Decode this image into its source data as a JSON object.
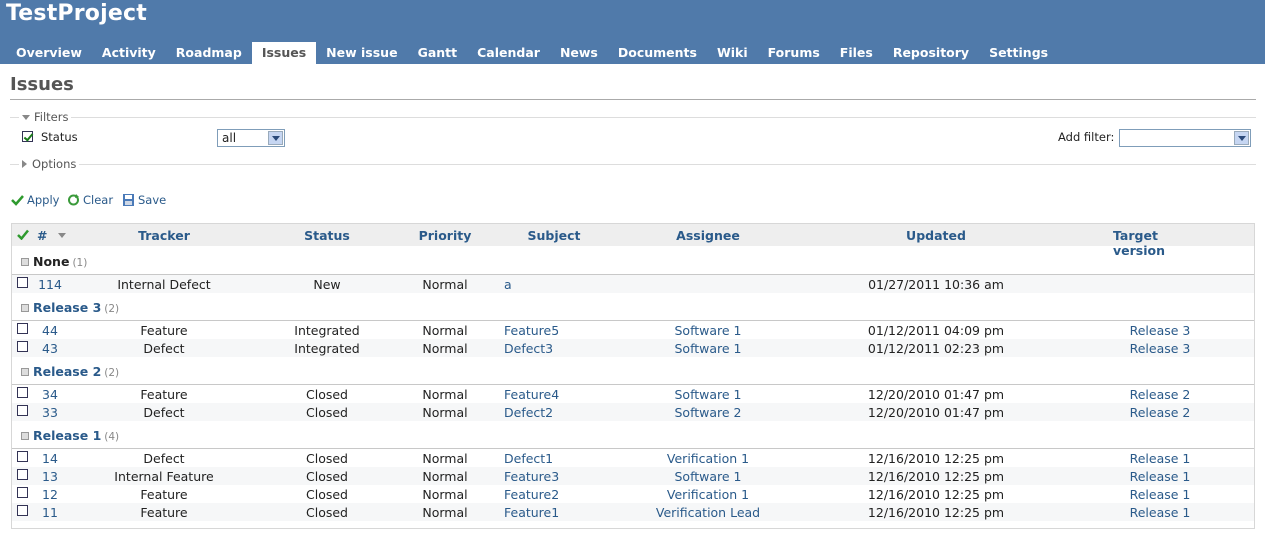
{
  "project": {
    "title": "TestProject"
  },
  "menu": [
    {
      "label": "Overview",
      "selected": false
    },
    {
      "label": "Activity",
      "selected": false
    },
    {
      "label": "Roadmap",
      "selected": false
    },
    {
      "label": "Issues",
      "selected": true
    },
    {
      "label": "New issue",
      "selected": false
    },
    {
      "label": "Gantt",
      "selected": false
    },
    {
      "label": "Calendar",
      "selected": false
    },
    {
      "label": "News",
      "selected": false
    },
    {
      "label": "Documents",
      "selected": false
    },
    {
      "label": "Wiki",
      "selected": false
    },
    {
      "label": "Forums",
      "selected": false
    },
    {
      "label": "Files",
      "selected": false
    },
    {
      "label": "Repository",
      "selected": false
    },
    {
      "label": "Settings",
      "selected": false
    }
  ],
  "page": {
    "title": "Issues"
  },
  "filters": {
    "legend": "Filters",
    "status_label": "Status",
    "status_checked": true,
    "status_value": "all",
    "add_filter_label": "Add filter:",
    "add_filter_value": ""
  },
  "options": {
    "legend": "Options"
  },
  "actions": {
    "apply": "Apply",
    "clear": "Clear",
    "save": "Save"
  },
  "table": {
    "columns": {
      "id": "#",
      "tracker": "Tracker",
      "status": "Status",
      "priority": "Priority",
      "subject": "Subject",
      "assignee": "Assignee",
      "updated": "Updated",
      "target_version": "Target version"
    },
    "groups": [
      {
        "name": "None",
        "count": "(1)",
        "issues": [
          {
            "id": "114",
            "tracker": "Internal Defect",
            "status": "New",
            "priority": "Normal",
            "subject": "a",
            "assignee": "",
            "updated": "01/27/2011 10:36 am",
            "target_version": ""
          }
        ]
      },
      {
        "name": "Release 3",
        "count": "(2)",
        "issues": [
          {
            "id": "44",
            "tracker": "Feature",
            "status": "Integrated",
            "priority": "Normal",
            "subject": "Feature5",
            "assignee": "Software 1",
            "updated": "01/12/2011 04:09 pm",
            "target_version": "Release 3"
          },
          {
            "id": "43",
            "tracker": "Defect",
            "status": "Integrated",
            "priority": "Normal",
            "subject": "Defect3",
            "assignee": "Software 1",
            "updated": "01/12/2011 02:23 pm",
            "target_version": "Release 3"
          }
        ]
      },
      {
        "name": "Release 2",
        "count": "(2)",
        "issues": [
          {
            "id": "34",
            "tracker": "Feature",
            "status": "Closed",
            "priority": "Normal",
            "subject": "Feature4",
            "assignee": "Software 1",
            "updated": "12/20/2010 01:47 pm",
            "target_version": "Release 2"
          },
          {
            "id": "33",
            "tracker": "Defect",
            "status": "Closed",
            "priority": "Normal",
            "subject": "Defect2",
            "assignee": "Software 2",
            "updated": "12/20/2010 01:47 pm",
            "target_version": "Release 2"
          }
        ]
      },
      {
        "name": "Release 1",
        "count": "(4)",
        "issues": [
          {
            "id": "14",
            "tracker": "Defect",
            "status": "Closed",
            "priority": "Normal",
            "subject": "Defect1",
            "assignee": "Verification 1",
            "updated": "12/16/2010 12:25 pm",
            "target_version": "Release 1"
          },
          {
            "id": "13",
            "tracker": "Internal Feature",
            "status": "Closed",
            "priority": "Normal",
            "subject": "Feature3",
            "assignee": "Software 1",
            "updated": "12/16/2010 12:25 pm",
            "target_version": "Release 1"
          },
          {
            "id": "12",
            "tracker": "Feature",
            "status": "Closed",
            "priority": "Normal",
            "subject": "Feature2",
            "assignee": "Verification 1",
            "updated": "12/16/2010 12:25 pm",
            "target_version": "Release 1"
          },
          {
            "id": "11",
            "tracker": "Feature",
            "status": "Closed",
            "priority": "Normal",
            "subject": "Feature1",
            "assignee": "Verification Lead",
            "updated": "12/16/2010 12:25 pm",
            "target_version": "Release 1"
          }
        ]
      }
    ]
  }
}
